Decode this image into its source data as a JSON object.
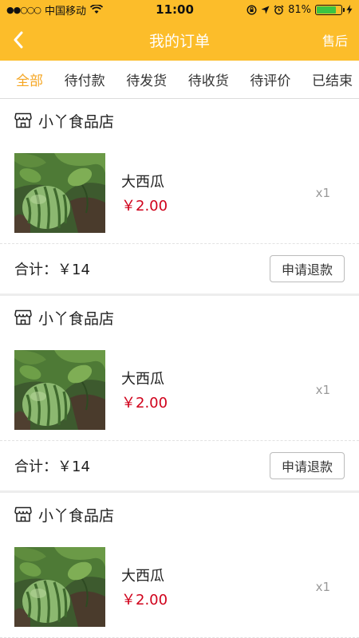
{
  "status_bar": {
    "signal": "●●○○○",
    "carrier": "中国移动",
    "time": "11:00",
    "battery_percent": "81%",
    "battery_level": 0.81,
    "battery_color": "#3cc442"
  },
  "nav": {
    "title": "我的订单",
    "right_label": "售后",
    "bg_color": "#fcbd2a"
  },
  "tabs": [
    {
      "label": "全部",
      "active": true
    },
    {
      "label": "待付款",
      "active": false
    },
    {
      "label": "待发货",
      "active": false
    },
    {
      "label": "待收货",
      "active": false
    },
    {
      "label": "待评价",
      "active": false
    },
    {
      "label": "已结束",
      "active": false
    }
  ],
  "orders": [
    {
      "shop_name": "小丫食品店",
      "product": {
        "name": "大西瓜",
        "price": "￥2.00",
        "qty": "x1"
      },
      "total": "合计：￥14",
      "action_label": "申请退款"
    },
    {
      "shop_name": "小丫食品店",
      "product": {
        "name": "大西瓜",
        "price": "￥2.00",
        "qty": "x1"
      },
      "total": "合计：￥14",
      "action_label": "申请退款"
    },
    {
      "shop_name": "小丫食品店",
      "product": {
        "name": "大西瓜",
        "price": "￥2.00",
        "qty": "x1"
      }
    }
  ],
  "colors": {
    "accent": "#f5a623",
    "price": "#d0021b"
  }
}
